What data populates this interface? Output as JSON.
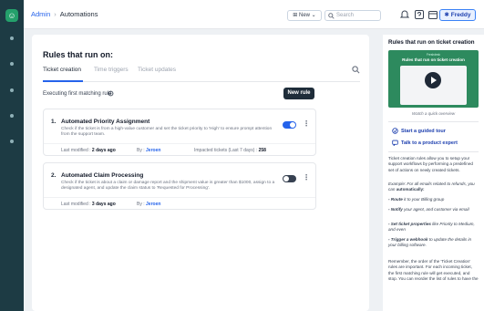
{
  "breadcrumb": {
    "root": "Admin",
    "current": "Automations"
  },
  "topbar": {
    "new_label": "New",
    "search_placeholder": "Search",
    "freddy_label": "Freddy"
  },
  "page": {
    "title": "Rules that run on:"
  },
  "tabs": [
    {
      "label": "Ticket creation",
      "active": true
    },
    {
      "label": "Time triggers",
      "active": false
    },
    {
      "label": "Ticket updates",
      "active": false
    }
  ],
  "exec_label": "Executing first matching rule",
  "new_rule_label": "New rule",
  "rules": [
    {
      "num": "1.",
      "name": "Automated Priority Assignment",
      "desc": "Check if the ticket is from a high-value customer and set the ticket priority to 'High' to ensure prompt attention from the support team.",
      "enabled": true,
      "meta_modified_label": "Last modified :",
      "meta_modified_value": "2 days ago",
      "meta_by_label": "By :",
      "meta_by_value": "Jeroen",
      "meta_impacted_label": "Impacted tickets (Last 7 days) :",
      "meta_impacted_value": "258"
    },
    {
      "num": "2.",
      "name": "Automated Claim Processing",
      "desc": "Check if the ticket is about a claim or damage report and the shipment value is greater than $1000, assign to a designated agent, and update the claim status to 'Requested for Processing'.",
      "enabled": false,
      "meta_modified_label": "Last modified :",
      "meta_modified_value": "3 days ago",
      "meta_by_label": "By :",
      "meta_by_value": "Jeroen"
    }
  ],
  "side": {
    "title": "Rules that run on ticket creation",
    "video_brand": "Freshdesk",
    "video_title": "Rules that run on ticket creation",
    "watch_label": "Watch a quick overview",
    "guided_tour": "Start a guided tour",
    "talk_expert": "Talk to a product expert",
    "para1": "Ticket creation rules allow you to setup your support workflows by performing a predefined set of actions on newly created tickets.",
    "para2_a": "Example: For all emails related to refunds, you can ",
    "para2_b": "automatically:",
    "b1_bold": "- Route",
    "b1_rest": " it to your Billing group",
    "b2_bold": "- Notify",
    "b2_rest": " your agent, and customer via email",
    "b3_bold": "- Set ticket properties",
    "b3_rest": " like Priority to Medium, and even",
    "b4_bold": "- Trigger a webhook",
    "b4_rest": " to update the details in your billing software.",
    "para3": "Remember, the order of the 'Ticket Creation' rules are important. For each incoming ticket, the first matching rule will get executed, and stop. You can reorder the list of rules to have the"
  },
  "colors": {
    "accent": "#2563eb",
    "rail": "#1d3b44",
    "toggle_on": "#2563eb",
    "toggle_off": "#374151",
    "video": "#2d8a5e"
  }
}
